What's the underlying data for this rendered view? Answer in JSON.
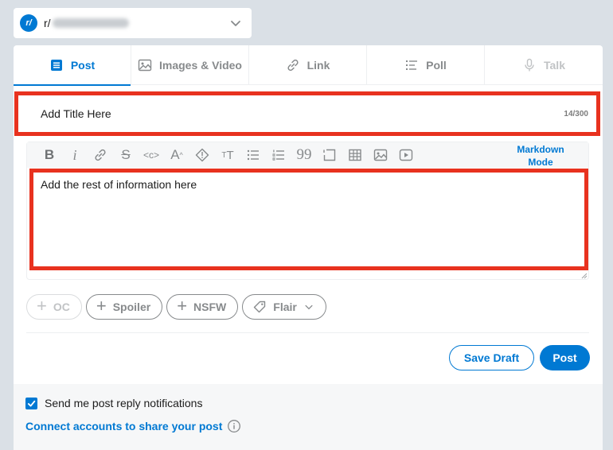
{
  "community": {
    "prefix": "r/",
    "icon": "reddit-community-icon",
    "dropdown_icon": "chevron-down-icon"
  },
  "tabs": [
    {
      "label": "Post",
      "icon": "post-icon",
      "state": "active"
    },
    {
      "label": "Images & Video",
      "icon": "image-icon",
      "state": "normal"
    },
    {
      "label": "Link",
      "icon": "link-icon",
      "state": "normal"
    },
    {
      "label": "Poll",
      "icon": "poll-icon",
      "state": "normal"
    },
    {
      "label": "Talk",
      "icon": "microphone-icon",
      "state": "disabled"
    }
  ],
  "title_field": {
    "value": "Add Title Here",
    "counter": "14/300"
  },
  "toolbar": {
    "buttons": [
      "bold",
      "italic",
      "link",
      "strikethrough",
      "inline-code",
      "superscript",
      "spoiler",
      "heading",
      "bulleted-list",
      "numbered-list",
      "quote-block",
      "code-block",
      "table",
      "image",
      "video"
    ],
    "markdown_mode": "Markdown Mode"
  },
  "body_field": {
    "value": "Add the rest of information here"
  },
  "tags": {
    "oc": "OC",
    "spoiler": "Spoiler",
    "nsfw": "NSFW",
    "flair": "Flair"
  },
  "actions": {
    "save_draft": "Save Draft",
    "post": "Post"
  },
  "footer": {
    "notify_label": "Send me post reply notifications",
    "notify_checked": true,
    "connect_label": "Connect accounts to share your post"
  },
  "colors": {
    "accent": "#0079d3",
    "highlight_border": "#e8321f",
    "page_background": "#dae0e6"
  }
}
